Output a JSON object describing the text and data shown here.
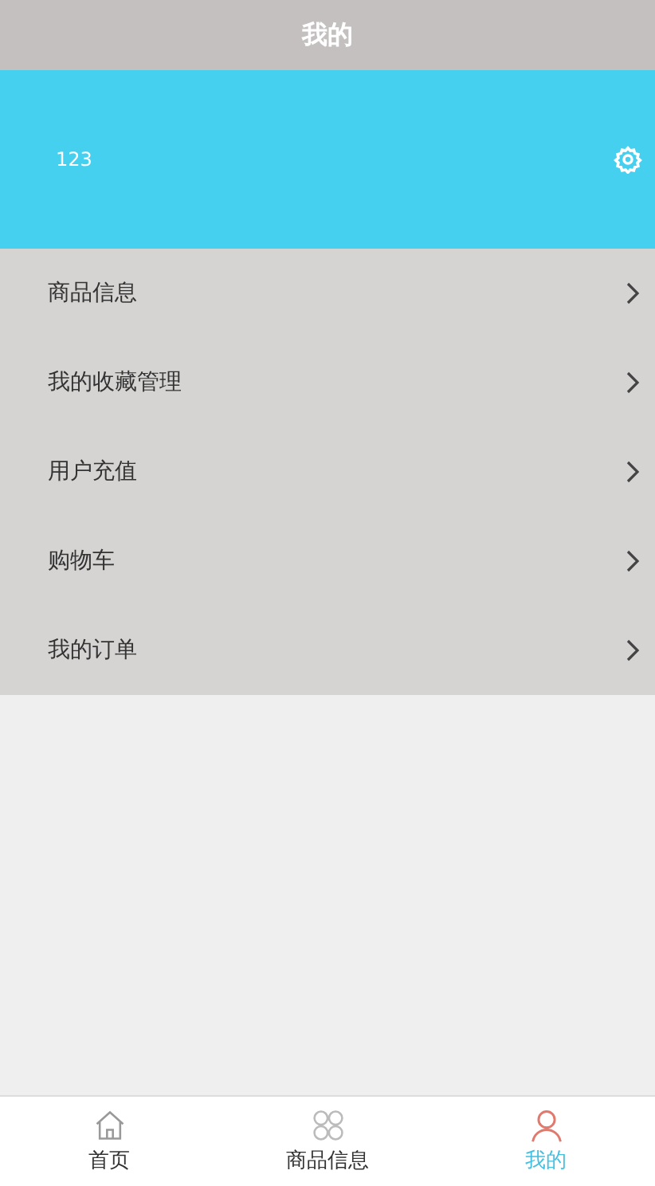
{
  "header": {
    "title": "我的"
  },
  "profile": {
    "username": "123"
  },
  "menu": [
    {
      "label": "商品信息"
    },
    {
      "label": "我的收藏管理"
    },
    {
      "label": "用户充值"
    },
    {
      "label": "购物车"
    },
    {
      "label": "我的订单"
    }
  ],
  "tabbar": [
    {
      "label": "首页",
      "kind": "home",
      "selected": false
    },
    {
      "label": "商品信息",
      "kind": "grid",
      "selected": false
    },
    {
      "label": "我的",
      "kind": "person",
      "selected": true
    }
  ]
}
